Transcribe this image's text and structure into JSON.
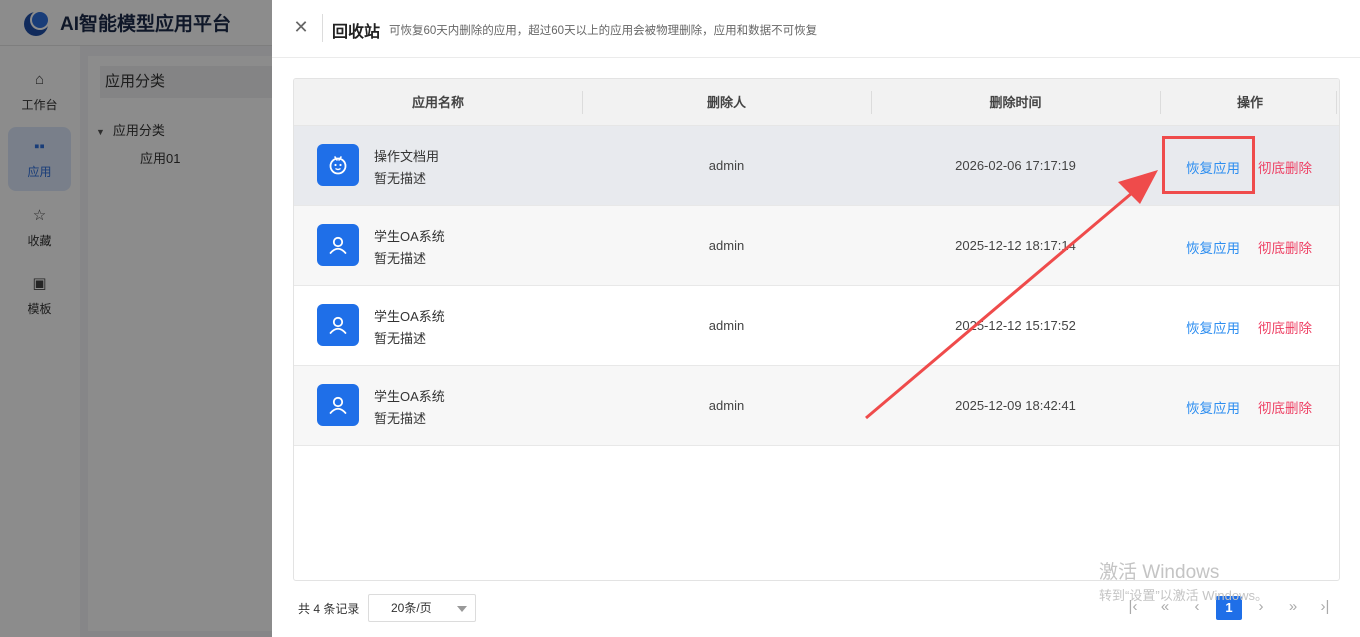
{
  "app": {
    "title": "AI智能模型应用平台"
  },
  "nav": {
    "items": [
      {
        "label": "工作台",
        "icon": "home-icon"
      },
      {
        "label": "应用",
        "icon": "grid-icon",
        "active": true
      },
      {
        "label": "收藏",
        "icon": "star-icon"
      },
      {
        "label": "模板",
        "icon": "template-icon"
      }
    ]
  },
  "category": {
    "header": "应用分类",
    "root": "应用分类",
    "child": "应用01"
  },
  "drawer": {
    "title": "回收站",
    "subtitle": "可恢复60天内删除的应用，超过60天以上的应用会被物理删除，应用和数据不可恢复",
    "close_icon": "close-icon"
  },
  "table": {
    "columns": [
      "应用名称",
      "删除人",
      "删除时间",
      "操作"
    ],
    "rows": [
      {
        "name": "操作文档用",
        "desc": "暂无描述",
        "deleter": "admin",
        "time": "2026-02-06 17:17:19",
        "icon": "robot-icon",
        "restore": "恢复应用",
        "delete": "彻底删除"
      },
      {
        "name": "学生OA系统",
        "desc": "暂无描述",
        "deleter": "admin",
        "time": "2025-12-12 18:17:14",
        "icon": "user-icon",
        "restore": "恢复应用",
        "delete": "彻底删除"
      },
      {
        "name": "学生OA系统",
        "desc": "暂无描述",
        "deleter": "admin",
        "time": "2025-12-12 15:17:52",
        "icon": "user-icon",
        "restore": "恢复应用",
        "delete": "彻底删除"
      },
      {
        "name": "学生OA系统",
        "desc": "暂无描述",
        "deleter": "admin",
        "time": "2025-12-09 18:42:41",
        "icon": "user-icon",
        "restore": "恢复应用",
        "delete": "彻底删除"
      }
    ]
  },
  "pagination": {
    "total": "共 4 条记录",
    "page_size": "20条/页",
    "current_page": "1"
  },
  "watermark": {
    "line1": "激活 Windows",
    "line2": "转到“设置”以激活 Windows。"
  },
  "colors": {
    "accent": "#1f6fe8",
    "link": "#2d8ef0",
    "danger": "#ee3f63",
    "annotation": "#ef4b4b"
  }
}
